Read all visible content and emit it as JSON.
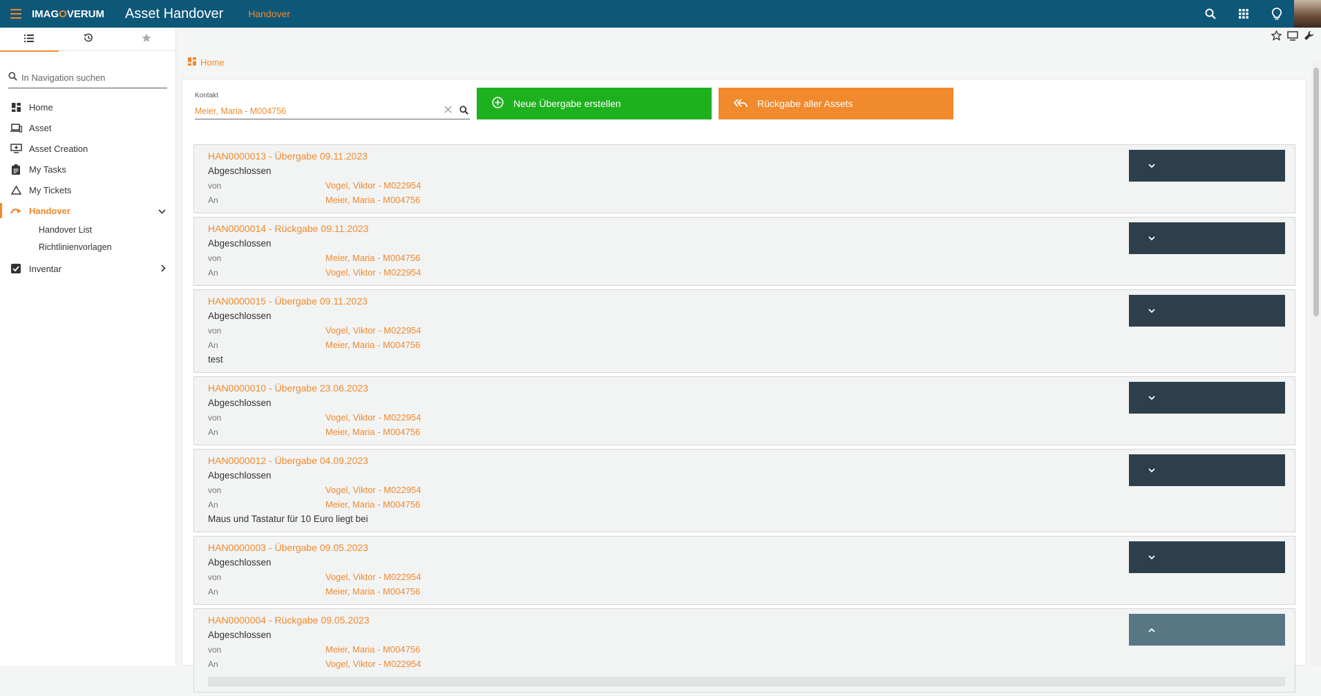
{
  "topbar": {
    "logo_pre": "IMAG",
    "logo_o": "O",
    "logo_post": "VERUM",
    "app_title": "Asset Handover",
    "context": "Handover",
    "icons": [
      "search-icon",
      "apps-grid-icon",
      "lightbulb-icon",
      "avatar"
    ]
  },
  "sidebar": {
    "tabs": [
      "list-icon",
      "history-icon",
      "star-icon"
    ],
    "search_placeholder": "In Navigation suchen",
    "items": [
      {
        "label": "Home",
        "icon": "dashboard-icon"
      },
      {
        "label": "Asset",
        "icon": "devices-icon"
      },
      {
        "label": "Asset Creation",
        "icon": "add-monitor-icon"
      },
      {
        "label": "My Tasks",
        "icon": "clipboard-icon"
      },
      {
        "label": "My Tickets",
        "icon": "warning-triangle-icon"
      },
      {
        "label": "Handover",
        "icon": "handover-icon"
      },
      {
        "label": "Inventar",
        "icon": "checkbox-icon"
      }
    ],
    "subitems": [
      "Handover List",
      "Richtlinienvorlagen"
    ]
  },
  "breadcrumb": {
    "label": "Home"
  },
  "contact": {
    "label": "Kontakt",
    "value": "Meier, Maria - M004756"
  },
  "buttons": {
    "new_handover": "Neue Übergabe erstellen",
    "return_all": "Rückgabe aller Assets"
  },
  "labels": {
    "from": "von",
    "to": "An"
  },
  "cards": [
    {
      "title": "HAN0000013 - Übergabe 09.11.2023",
      "status": "Abgeschlossen",
      "from": "Vogel, Viktor - M022954",
      "to": "Meier, Maria - M004756",
      "note": ""
    },
    {
      "title": "HAN0000014 - Rückgabe 09.11.2023",
      "status": "Abgeschlossen",
      "from": "Meier, Maria - M004756",
      "to": "Vogel, Viktor - M022954",
      "note": ""
    },
    {
      "title": "HAN0000015 - Übergabe 09.11.2023",
      "status": "Abgeschlossen",
      "from": "Vogel, Viktor - M022954",
      "to": "Meier, Maria - M004756",
      "note": "test"
    },
    {
      "title": "HAN0000010 - Übergabe 23.06.2023",
      "status": "Abgeschlossen",
      "from": "Vogel, Viktor - M022954",
      "to": "Meier, Maria - M004756",
      "note": ""
    },
    {
      "title": "HAN0000012 - Übergabe 04.09.2023",
      "status": "Abgeschlossen",
      "from": "Vogel, Viktor - M022954",
      "to": "Meier, Maria - M004756",
      "note": "Maus und Tastatur für 10 Euro liegt bei"
    },
    {
      "title": "HAN0000003 - Übergabe 09.05.2023",
      "status": "Abgeschlossen",
      "from": "Vogel, Viktor - M022954",
      "to": "Meier, Maria - M004756",
      "note": ""
    },
    {
      "title": "HAN0000004 - Rückgabe 09.05.2023",
      "status": "Abgeschlossen",
      "from": "Meier, Maria - M004756",
      "to": "Vogel, Viktor - M022954",
      "note": "",
      "expanded": true
    }
  ],
  "colors": {
    "topbar": "#0d5779",
    "accent": "#f08a2c",
    "new_button": "#1eb11e",
    "toggle": "#2d3f4a",
    "toggle_open": "#587684"
  }
}
